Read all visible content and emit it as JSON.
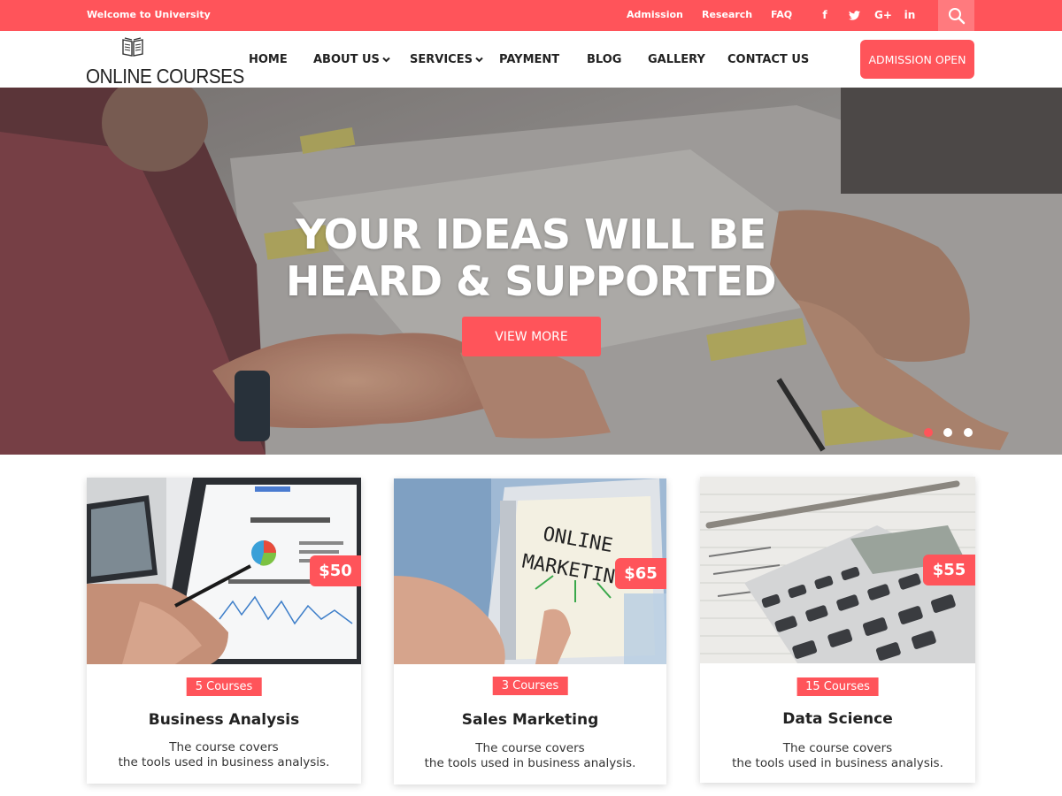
{
  "topbar": {
    "welcome": "Welcome to University",
    "links": [
      "Admission",
      "Research",
      "FAQ"
    ],
    "social": [
      "facebook-icon",
      "twitter-icon",
      "google-plus-icon",
      "linkedin-icon"
    ],
    "social_glyphs": [
      "f",
      "t",
      "G+",
      "in"
    ],
    "bg_color": "#ff545a"
  },
  "header": {
    "logo_text": "ONLINE COURSES",
    "nav": [
      "HOME",
      "ABOUT US",
      "SERVICES",
      "PAYMENT",
      "BLOG",
      "GALLERY",
      "CONTACT US"
    ],
    "cta": "ADMISSION OPEN"
  },
  "hero": {
    "title_line1": "YOUR IDEAS WILL BE",
    "title_line2": "HEARD & SUPPORTED",
    "button": "VIEW MORE",
    "slides": 3,
    "active_slide": 1
  },
  "cards": [
    {
      "price": "$50",
      "count": "5 Courses",
      "title": "Business Analysis",
      "desc_line1": "The course covers",
      "desc_line2": "the tools used in business analysis."
    },
    {
      "price": "$65",
      "count": "3 Courses",
      "title": "Sales Marketing",
      "desc_line1": "The course covers",
      "desc_line2": "the tools used in business analysis."
    },
    {
      "price": "$55",
      "count": "15 Courses",
      "title": "Data Science",
      "desc_line1": "The course covers",
      "desc_line2": "the tools used in business analysis."
    }
  ],
  "card_image_text": {
    "marketing_line1": "ONLINE",
    "marketing_line2": "MARKETIN"
  },
  "colors": {
    "accent": "#ff545a"
  }
}
